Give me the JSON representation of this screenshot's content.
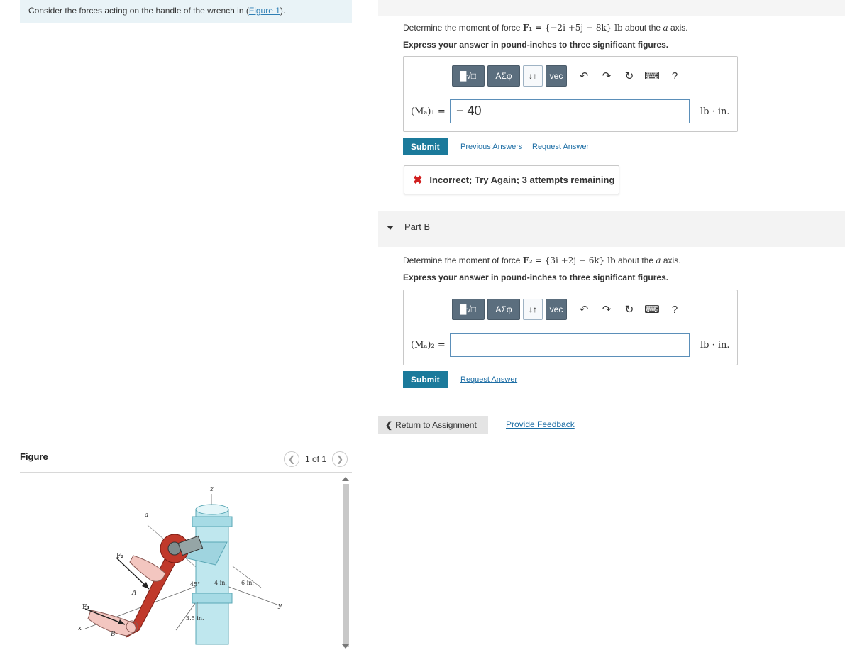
{
  "left": {
    "prompt": "Consider the forces acting on the handle of the wrench in",
    "figure_link": "Figure 1",
    "prompt_end": ").",
    "figure_title": "Figure",
    "pager": "1 of 1",
    "figure_labels": {
      "z": "z",
      "a": "a",
      "F2": "F₂",
      "F1": "F₁",
      "A": "A",
      "B": "B",
      "x": "x",
      "y": "y",
      "angle": "45°",
      "dim1": "4 in.",
      "dim2": "6 in.",
      "dim3": "3.5 in."
    }
  },
  "partA": {
    "question_prefix": "Determine the moment of force",
    "force_name": "F₁",
    "force_value": "= {−2i +5j − 8k} lb",
    "question_suffix": "about the",
    "axis": "a",
    "question_end": "axis.",
    "instruction": "Express your answer in pound-inches to three significant figures.",
    "toolbar": {
      "greek": "ΑΣφ",
      "arrows": "↓↑",
      "vec": "vec",
      "help": "?"
    },
    "label": "(Mₐ)₁ =",
    "value": "− 40",
    "unit": "lb · in.",
    "submit": "Submit",
    "previous_answers": "Previous Answers",
    "request_answer": "Request Answer",
    "feedback": "Incorrect; Try Again; 3 attempts remaining"
  },
  "partB": {
    "title": "Part B",
    "question_prefix": "Determine the moment of force",
    "force_name": "F₂",
    "force_value": "= {3i +2j − 6k} lb",
    "question_suffix": "about the",
    "axis": "a",
    "question_end": "axis.",
    "instruction": "Express your answer in pound-inches to three significant figures.",
    "toolbar": {
      "greek": "ΑΣφ",
      "arrows": "↓↑",
      "vec": "vec",
      "help": "?"
    },
    "label": "(Mₐ)₂ =",
    "value": "",
    "unit": "lb · in.",
    "submit": "Submit",
    "request_answer": "Request Answer"
  },
  "footer": {
    "return": "Return to Assignment",
    "provide_feedback": "Provide Feedback"
  }
}
